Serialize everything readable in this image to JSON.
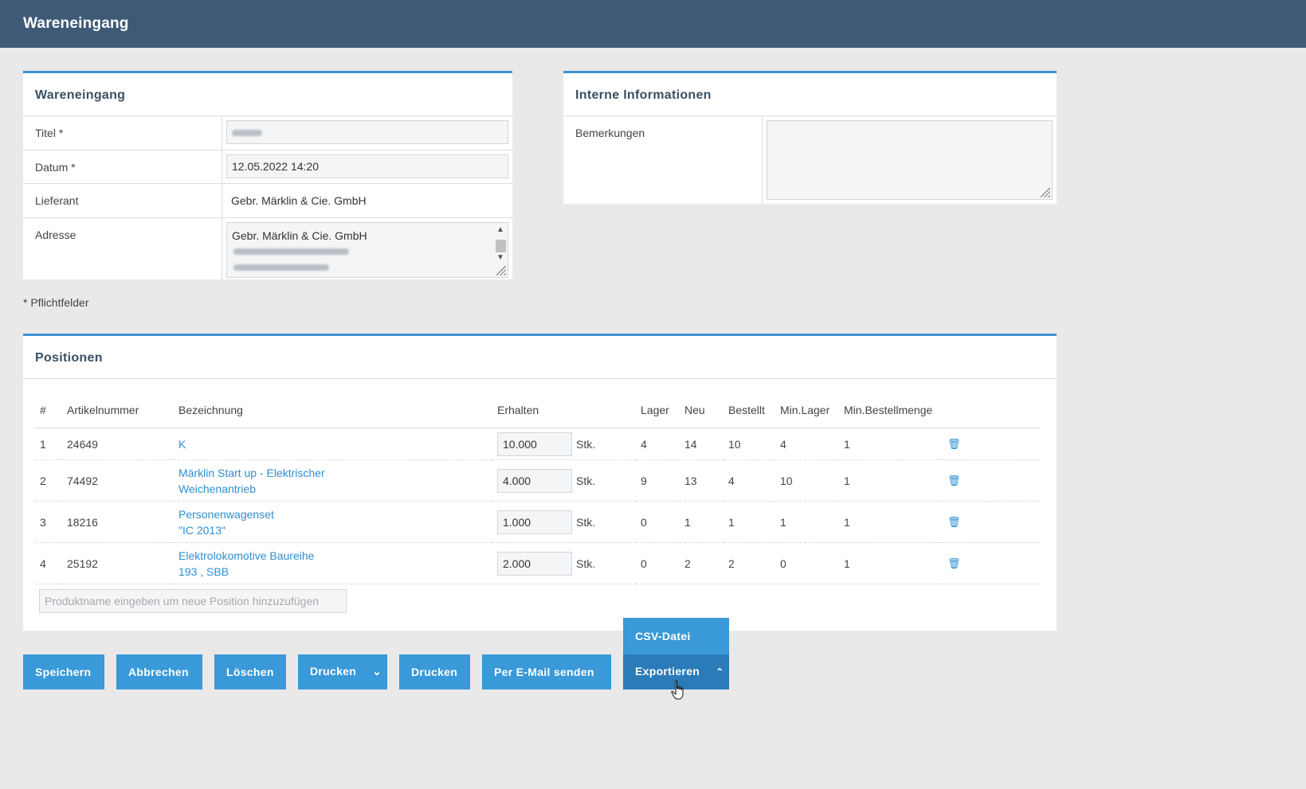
{
  "header": {
    "title": "Wareneingang"
  },
  "receipt_panel": {
    "heading": "Wareneingang",
    "fields": {
      "title_label": "Titel *",
      "date_label": "Datum *",
      "date_value": "12.05.2022 14:20",
      "supplier_label": "Lieferant",
      "supplier_value": "Gebr. Märklin & Cie. GmbH",
      "address_label": "Adresse",
      "address_line1": "Gebr. Märklin & Cie. GmbH"
    }
  },
  "internal_panel": {
    "heading": "Interne Informationen",
    "remarks_label": "Bemerkungen"
  },
  "required_note": "* Pflichtfelder",
  "positions": {
    "heading": "Positionen",
    "columns": [
      "#",
      "Artikelnummer",
      "Bezeichnung",
      "Erhalten",
      "Lager",
      "Neu",
      "Bestellt",
      "Min.Lager",
      "Min.Bestellmenge"
    ],
    "rows": [
      {
        "num": "1",
        "article": "24649",
        "name1": "K",
        "name2": "",
        "qty": "10.000",
        "unit": "Stk.",
        "stock": "4",
        "new": "14",
        "ordered": "10",
        "min_stock": "4",
        "min_order": "1"
      },
      {
        "num": "2",
        "article": "74492",
        "name1": "Märklin Start up - Elektrischer",
        "name2": "Weichenantrieb",
        "qty": "4.000",
        "unit": "Stk.",
        "stock": "9",
        "new": "13",
        "ordered": "4",
        "min_stock": "10",
        "min_order": "1"
      },
      {
        "num": "3",
        "article": "18216",
        "name1": "Personenwagenset",
        "name2": "\"IC 2013\"",
        "qty": "1.000",
        "unit": "Stk.",
        "stock": "0",
        "new": "1",
        "ordered": "1",
        "min_stock": "1",
        "min_order": "1"
      },
      {
        "num": "4",
        "article": "25192",
        "name1": "Elektrolokomotive Baureihe",
        "name2": "193 , SBB",
        "qty": "2.000",
        "unit": "Stk.",
        "stock": "0",
        "new": "2",
        "ordered": "2",
        "min_stock": "0",
        "min_order": "1"
      }
    ],
    "add_placeholder": "Produktname eingeben um neue Position hinzuzufügen"
  },
  "buttons": {
    "save": "Speichern",
    "cancel": "Abbrechen",
    "delete": "Löschen",
    "print_menu": "Drucken",
    "print": "Drucken",
    "email": "Per E-Mail senden",
    "export": "Exportieren",
    "export_csv": "CSV-Datei"
  },
  "icons": {
    "trash": "trash-icon",
    "chevron_down": "chevron-down-icon",
    "chevron_up": "chevron-up-icon"
  },
  "colors": {
    "header_bg": "#3f5a77",
    "accent": "#3a99d8",
    "accent_dark": "#2a7bb8",
    "link": "#2f8fcf",
    "page_bg": "#e9e9e9"
  }
}
